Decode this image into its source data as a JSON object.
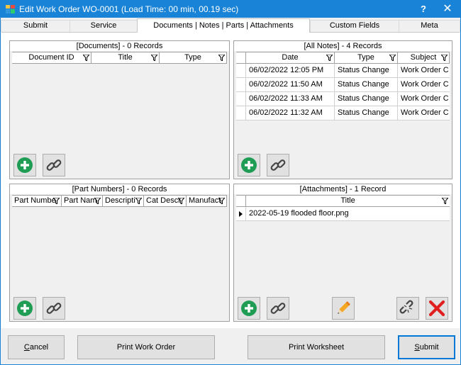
{
  "window": {
    "title": "Edit Work Order WO-0001 (Load Time: 00 min, 00.19 sec)",
    "help": "?",
    "close": "✕"
  },
  "tabs": [
    {
      "label": "Submit"
    },
    {
      "label": "Service"
    },
    {
      "label": "Documents | Notes | Parts | Attachments"
    },
    {
      "label": "Custom Fields"
    },
    {
      "label": "Meta"
    }
  ],
  "documents": {
    "caption": "[Documents] - 0 Records",
    "columns": [
      "Document ID",
      "Title",
      "Type"
    ]
  },
  "notes": {
    "caption": "[All Notes] - 4 Records",
    "columns": [
      "Date",
      "Type",
      "Subject"
    ],
    "rows": [
      {
        "date": "06/02/2022 12:05 PM",
        "type": "Status Change",
        "subject": "Work Order C"
      },
      {
        "date": "06/02/2022 11:50 AM",
        "type": "Status Change",
        "subject": "Work Order C"
      },
      {
        "date": "06/02/2022 11:33 AM",
        "type": "Status Change",
        "subject": "Work Order C"
      },
      {
        "date": "06/02/2022 11:32 AM",
        "type": "Status Change",
        "subject": "Work Order C"
      }
    ]
  },
  "parts": {
    "caption": "[Part Numbers] - 0 Records",
    "columns": [
      "Part Numbe",
      "Part Nam",
      "Descripti",
      "Cat Descr",
      "Manufact"
    ]
  },
  "attachments": {
    "caption": "[Attachments] - 1 Record",
    "columns": [
      "Title"
    ],
    "rows": [
      {
        "title": "2022-05-19 flooded floor.png"
      }
    ]
  },
  "buttons": {
    "cancel_first": "C",
    "cancel_rest": "ancel",
    "print_work_order": "Print Work Order",
    "print_worksheet": "Print Worksheet",
    "submit_first": "S",
    "submit_rest": "ubmit"
  },
  "colors": {
    "titlebar": "#1883d7",
    "add_green": "#1f9d55",
    "delete_red": "#e02020"
  }
}
